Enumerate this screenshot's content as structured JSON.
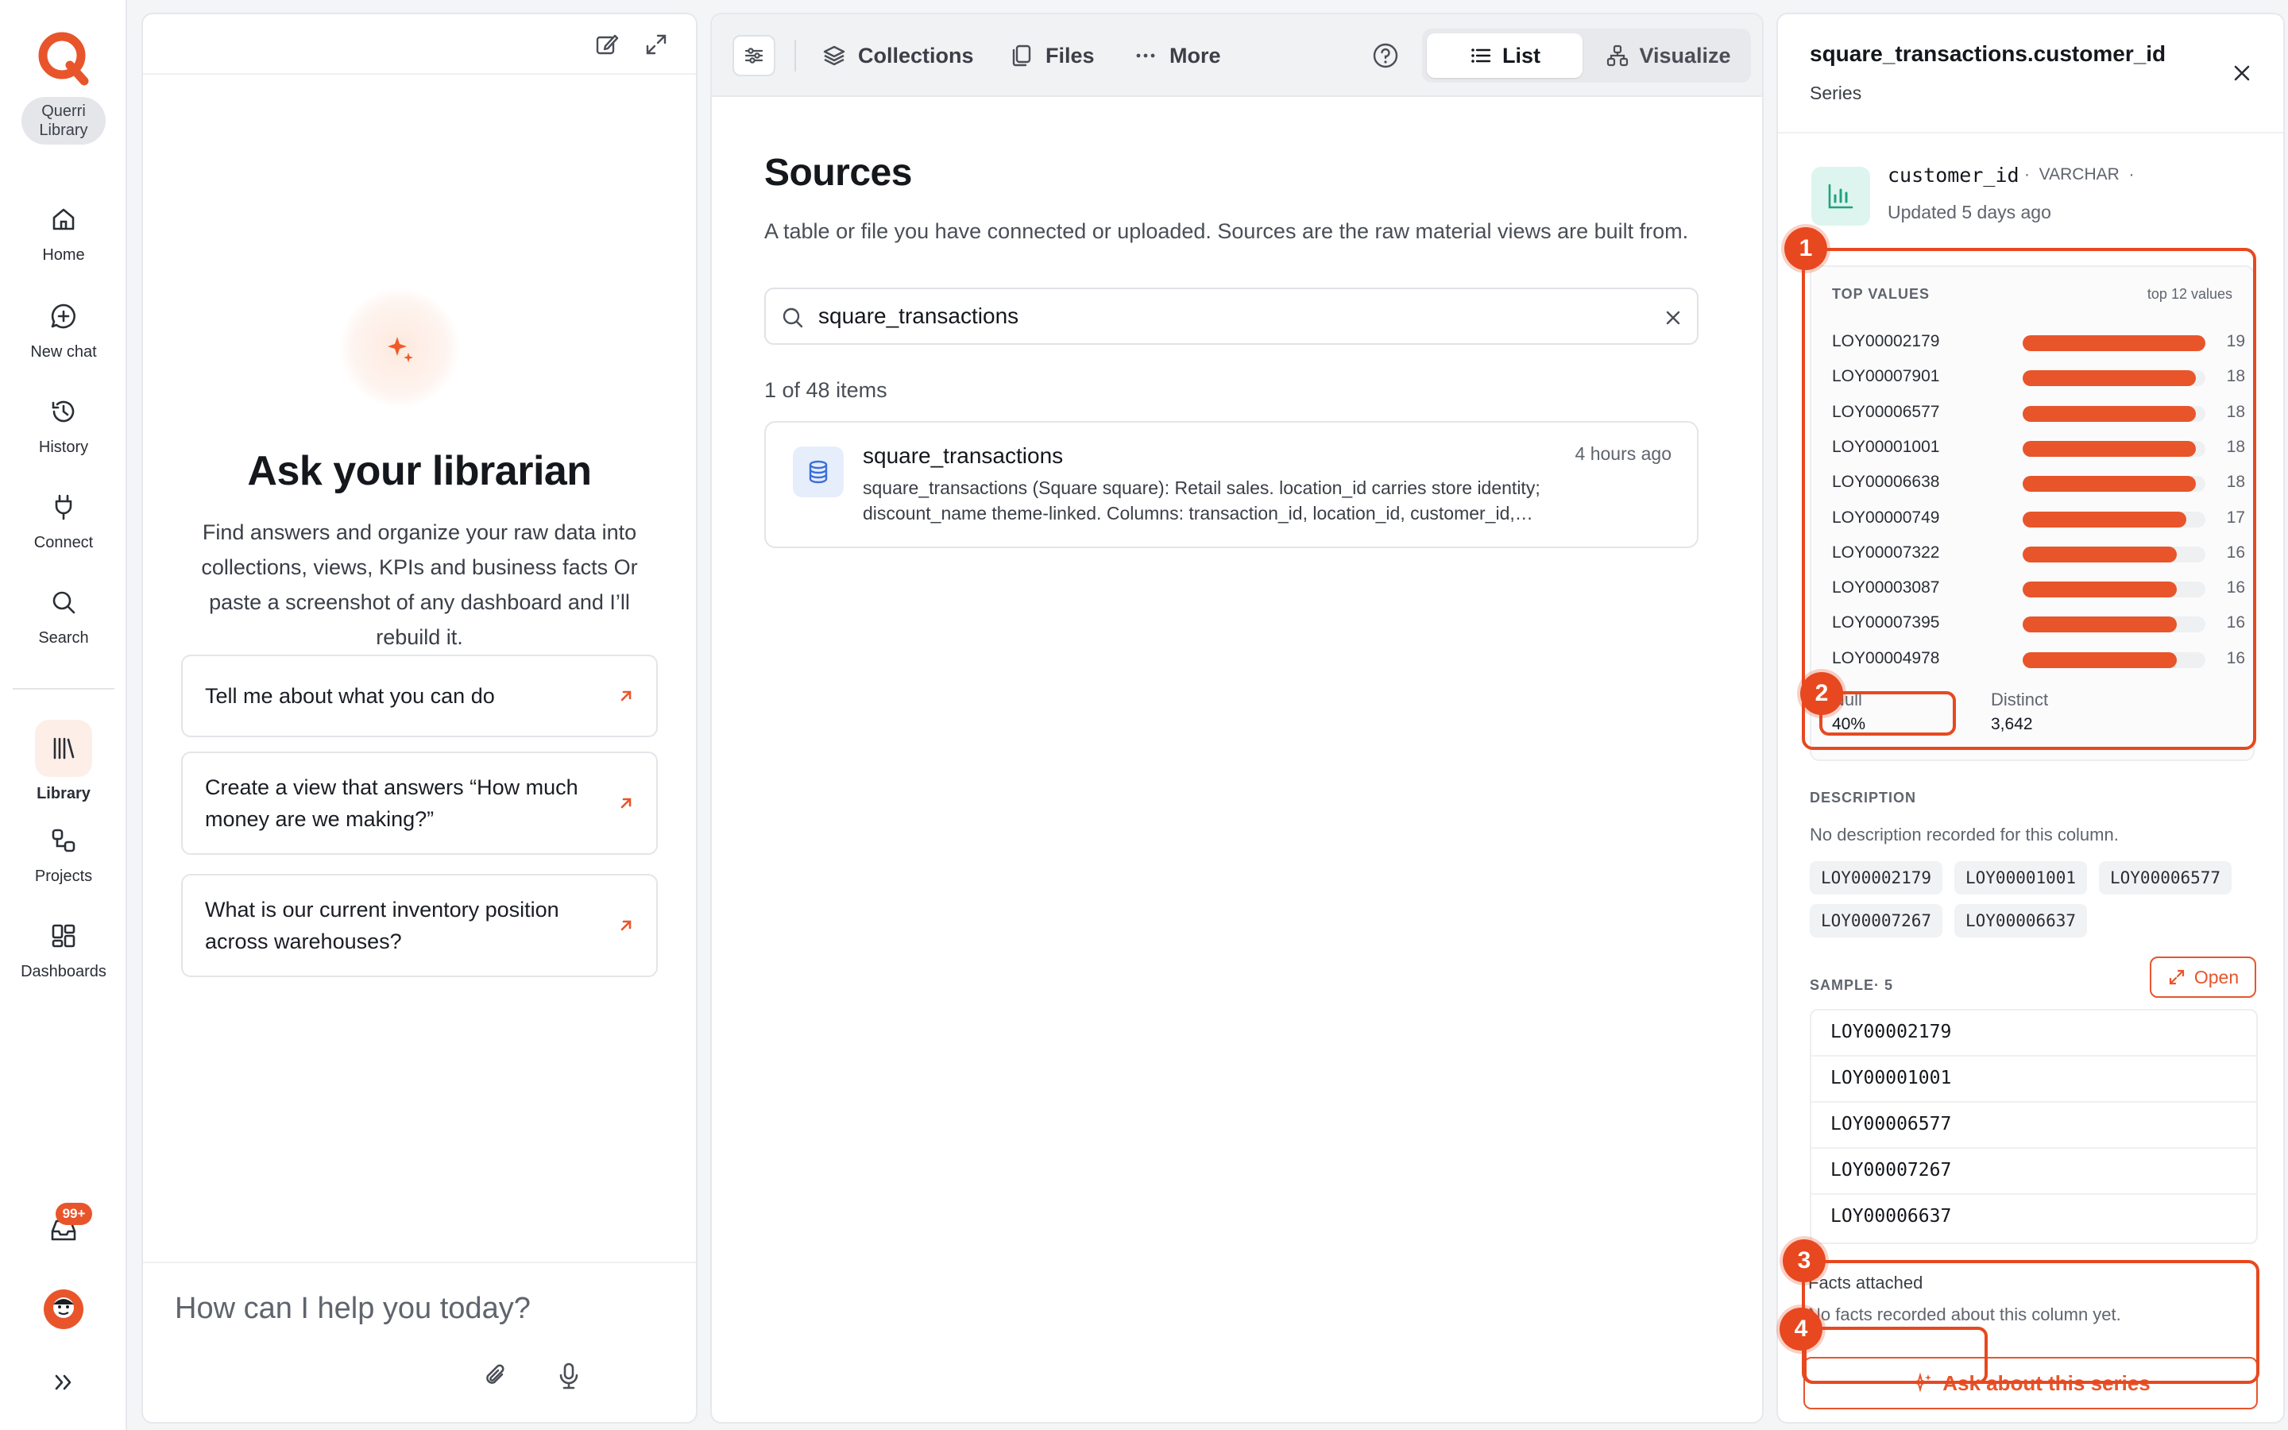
{
  "app": {
    "brand": "Querri",
    "library_pill": "Querri Library",
    "accent": "#e8552b"
  },
  "nav": {
    "items": [
      {
        "label": "Home",
        "icon": "home-icon"
      },
      {
        "label": "New chat",
        "icon": "chat-plus-icon"
      },
      {
        "label": "History",
        "icon": "history-icon"
      },
      {
        "label": "Connect",
        "icon": "plug-icon"
      },
      {
        "label": "Search",
        "icon": "search-icon"
      },
      {
        "label": "Library",
        "icon": "library-icon"
      },
      {
        "label": "Projects",
        "icon": "projects-icon"
      },
      {
        "label": "Dashboards",
        "icon": "dashboards-icon"
      }
    ],
    "inbox_badge": "99+"
  },
  "chat": {
    "title": "Ask your librarian",
    "subtitle": "Find answers and organize your raw data into collections, views, KPIs and business facts Or paste a screenshot of any dashboard and I’ll rebuild it.",
    "suggestions": [
      "Tell me about what you can do",
      "Create a view that answers “How much money are we making?”",
      "What is our current inventory position across warehouses?"
    ],
    "input_placeholder": "How can I help you today?"
  },
  "toolbar": {
    "collections": "Collections",
    "files": "Files",
    "more": "More",
    "view_list": "List",
    "view_visualize": "Visualize"
  },
  "sources": {
    "title": "Sources",
    "subtitle": "A table or file you have connected or uploaded. Sources are the raw material views are built from.",
    "search_value": "square_transactions",
    "count_text": "1 of 48 items",
    "items": [
      {
        "name": "square_transactions",
        "time": "4 hours ago",
        "desc_line1": "square_transactions (Square square): Retail sales. location_id carries store identity;",
        "desc_line2": "discount_name theme-linked. Columns: transaction_id, location_id, customer_id,…"
      }
    ]
  },
  "details": {
    "title": "square_transactions.customer_id",
    "kind": "Series",
    "column_name": "customer_id",
    "column_type": "VARCHAR",
    "updated": "Updated 5 days ago",
    "top_values_label": "TOP VALUES",
    "top_values_note": "top 12 values",
    "top_values": [
      {
        "key": "LOY00002179",
        "count": 19
      },
      {
        "key": "LOY00007901",
        "count": 18
      },
      {
        "key": "LOY00006577",
        "count": 18
      },
      {
        "key": "LOY00001001",
        "count": 18
      },
      {
        "key": "LOY00006638",
        "count": 18
      },
      {
        "key": "LOY00000749",
        "count": 17
      },
      {
        "key": "LOY00007322",
        "count": 16
      },
      {
        "key": "LOY00003087",
        "count": 16
      },
      {
        "key": "LOY00007395",
        "count": 16
      },
      {
        "key": "LOY00004978",
        "count": 16
      }
    ],
    "null_label": "Null",
    "null_value": "40%",
    "distinct_label": "Distinct",
    "distinct_value": "3,642",
    "description_label": "DESCRIPTION",
    "description_text": "No description recorded for this column.",
    "chips": [
      "LOY00002179",
      "LOY00001001",
      "LOY00006577",
      "LOY00007267",
      "LOY00006637"
    ],
    "sample_label": "SAMPLE· 5",
    "open_label": "Open",
    "samples": [
      "LOY00002179",
      "LOY00001001",
      "LOY00006577",
      "LOY00007267",
      "LOY00006637"
    ],
    "facts_label": "Facts attached",
    "facts_text": "No facts recorded about this column yet.",
    "ask_label": "Ask about this series"
  },
  "annotations": [
    "1",
    "2",
    "3",
    "4"
  ]
}
